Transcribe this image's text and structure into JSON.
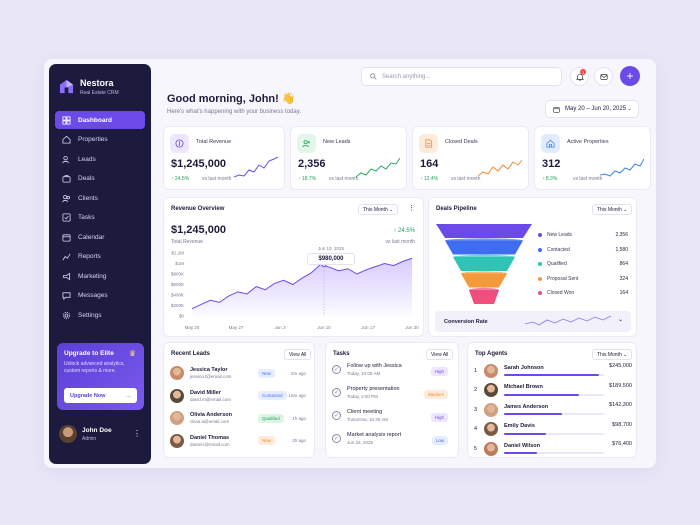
{
  "brand": {
    "name": "Nestora",
    "subtitle": "Real Estate CRM"
  },
  "nav": [
    {
      "label": "Dashboard",
      "icon": "grid-icon",
      "active": true
    },
    {
      "label": "Properties",
      "icon": "home-icon"
    },
    {
      "label": "Leads",
      "icon": "users-icon"
    },
    {
      "label": "Deals",
      "icon": "briefcase-icon"
    },
    {
      "label": "Clients",
      "icon": "user-group-icon"
    },
    {
      "label": "Tasks",
      "icon": "checkbox-icon"
    },
    {
      "label": "Calendar",
      "icon": "calendar-icon"
    },
    {
      "label": "Reports",
      "icon": "chart-icon"
    },
    {
      "label": "Marketing",
      "icon": "megaphone-icon"
    },
    {
      "label": "Messages",
      "icon": "chat-icon"
    },
    {
      "label": "Settings",
      "icon": "gear-icon"
    }
  ],
  "upgrade": {
    "title": "Upgrade to Elite",
    "description": "Unlock advanced analytics, custom reports & more.",
    "button": "Upgrade Now"
  },
  "user": {
    "name": "John Doe",
    "role": "Admin"
  },
  "header": {
    "greeting": "Good morning, John! 👋",
    "subtitle": "Here's what's happening with your business today.",
    "search_placeholder": "Search anything...",
    "notification_count": "3",
    "date_range": "May 20 – Jun 20, 2025"
  },
  "kpis": [
    {
      "label": "Total Revenue",
      "value": "$1,245,000",
      "delta": "↑ 24.5%",
      "vs": "vs last month",
      "color": "#6b4ae8",
      "bg": "#ece6ff",
      "icon": "dollar-icon"
    },
    {
      "label": "New Leads",
      "value": "2,356",
      "delta": "↑ 18.7%",
      "vs": "vs last month",
      "color": "#2ea864",
      "bg": "#e3f6ea",
      "icon": "user-plus-icon"
    },
    {
      "label": "Closed Deals",
      "value": "164",
      "delta": "↑ 12.4%",
      "vs": "vs last month",
      "color": "#f08a3a",
      "bg": "#fdebdc",
      "icon": "document-icon"
    },
    {
      "label": "Active Properties",
      "value": "312",
      "delta": "↑ 8.3%",
      "vs": "vs last month",
      "color": "#3b82f6",
      "bg": "#e2ecff",
      "icon": "house-icon"
    }
  ],
  "revenue": {
    "title": "Revenue Overview",
    "filter": "This Month",
    "value": "$1,245,000",
    "value_label": "Total Revenue",
    "delta": "↑ 24.5%",
    "vs": "vs last month",
    "tooltip_date": "Jun 10, 2025",
    "tooltip_value": "$980,000"
  },
  "chart_data": {
    "type": "area",
    "x": [
      "May 20",
      "May 27",
      "Jun 3",
      "Jun 10",
      "Jun 17",
      "Jun 20"
    ],
    "y_ticks": [
      "$1.2M",
      "$1M",
      "$800K",
      "$600K",
      "$400K",
      "$200K",
      "$0"
    ],
    "ylim": [
      0,
      1200000
    ],
    "series": [
      {
        "values": [
          140000,
          220000,
          300000,
          260000,
          380000,
          460000,
          420000,
          560000,
          500000,
          620000,
          680000,
          600000,
          720000,
          820000,
          980000,
          930000,
          860000,
          900000,
          800000,
          880000,
          940000,
          1000000,
          960000,
          1040000,
          1100000
        ]
      }
    ],
    "highlight": {
      "x": "Jun 10",
      "y": 980000
    },
    "color": "#6b4ae8"
  },
  "pipeline": {
    "title": "Deals Pipeline",
    "filter": "This Month",
    "stages": [
      {
        "label": "New Leads",
        "value": "2,356",
        "color": "#6b4ae8"
      },
      {
        "label": "Contacted",
        "value": "1,580",
        "color": "#3f6df0"
      },
      {
        "label": "Qualified",
        "value": "864",
        "color": "#2ec4b6"
      },
      {
        "label": "Proposal Sent",
        "value": "324",
        "color": "#f39a3c"
      },
      {
        "label": "Closed Won",
        "value": "164",
        "color": "#ef4f7c"
      }
    ],
    "conversion_label": "Conversion Rate"
  },
  "recent_leads": {
    "title": "Recent Leads",
    "view_all": "View All",
    "rows": [
      {
        "name": "Jessica Taylor",
        "email": "jessica.t@email.com",
        "tag": "New",
        "tag_color": "#3f6df0",
        "tag_bg": "#e6edff",
        "time": "2m ago"
      },
      {
        "name": "David Miller",
        "email": "david.m@email.com",
        "tag": "Contacted",
        "tag_color": "#3f6df0",
        "tag_bg": "#e6edff",
        "time": "15m ago"
      },
      {
        "name": "Olivia Anderson",
        "email": "olivia.a@email.com",
        "tag": "Qualified",
        "tag_color": "#20a05a",
        "tag_bg": "#def5e6",
        "time": "1h ago"
      },
      {
        "name": "Daniel Thomas",
        "email": "daniel.t@email.com",
        "tag": "New",
        "tag_color": "#f08a3a",
        "tag_bg": "#fdebdc",
        "time": "2h ago"
      }
    ]
  },
  "tasks": {
    "title": "Tasks",
    "view_all": "View All",
    "rows": [
      {
        "title": "Follow up with Jessica",
        "time": "Today, 10:00 AM",
        "tag": "High",
        "tag_color": "#6b4ae8",
        "tag_bg": "#ece6ff"
      },
      {
        "title": "Property presentation",
        "time": "Today, 2:00 PM",
        "tag": "Medium",
        "tag_color": "#f08a3a",
        "tag_bg": "#fdebdc"
      },
      {
        "title": "Client meeting",
        "time": "Tomorrow, 10:30 AM",
        "tag": "High",
        "tag_color": "#6b4ae8",
        "tag_bg": "#ece6ff"
      },
      {
        "title": "Market analysis report",
        "time": "Jun 22, 2025",
        "tag": "Low",
        "tag_color": "#3f6df0",
        "tag_bg": "#e6edff"
      }
    ]
  },
  "top_agents": {
    "title": "Top Agents",
    "filter": "This Month",
    "rows": [
      {
        "rank": "1",
        "name": "Sarah Johnson",
        "amount": "$245,000",
        "share": 0.95
      },
      {
        "rank": "2",
        "name": "Michael Brown",
        "amount": "$189,500",
        "share": 0.75
      },
      {
        "rank": "3",
        "name": "James Anderson",
        "amount": "$142,300",
        "share": 0.58
      },
      {
        "rank": "4",
        "name": "Emily Davis",
        "amount": "$98,700",
        "share": 0.42
      },
      {
        "rank": "5",
        "name": "Daniel Wilson",
        "amount": "$76,400",
        "share": 0.33
      }
    ]
  }
}
